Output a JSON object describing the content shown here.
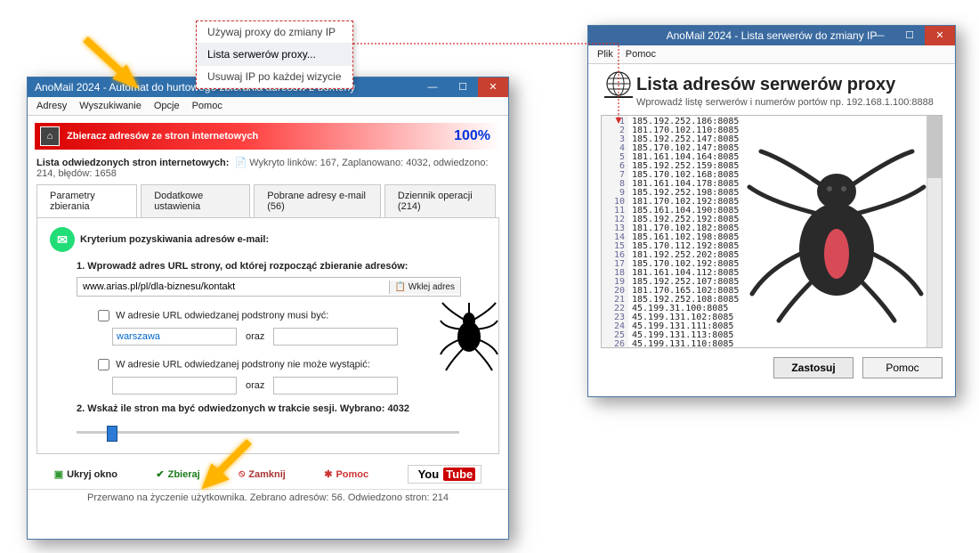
{
  "popup": {
    "items": [
      "Używaj proxy do zmiany IP",
      "Lista serwerów proxy...",
      "Usuwaj IP po każdej wizycie"
    ]
  },
  "main": {
    "title": "AnoMail 2024 - Automat do hurtowego zbierania adresów z domeny",
    "menu": {
      "adresy": "Adresy",
      "wyszukiwanie": "Wyszukiwanie",
      "opcje": "Opcje",
      "pomoc": "Pomoc"
    },
    "banner": "Zbieracz adresów ze stron internetowych",
    "percent": "100%",
    "stats_label": "Lista odwiedzonych stron internetowych:",
    "stats_value": "Wykryto linków: 167, Zaplanowano: 4032, odwiedzono: 214, błędów: 1658",
    "tabs": [
      "Parametry zbierania",
      "Dodatkowe ustawienia",
      "Pobrane adresy e-mail (56)",
      "Dziennik operacji (214)"
    ],
    "criteria_header": "Kryterium pozyskiwania adresów e-mail:",
    "step1": "1. Wprowadź adres URL strony, od której rozpocząć zbieranie adresów:",
    "url": "www.arias.pl/pl/dla-biznesu/kontakt",
    "paste_label": "Wklej adres",
    "must_label": "W adresie URL odwiedzanej podstrony musi być:",
    "must_value": "warszawa",
    "oraz": "oraz",
    "mustnot_label": "W adresie URL odwiedzanej podstrony nie może wystąpić:",
    "step2": "2. Wskaż ile stron ma być odwiedzonych w trakcie sesji. Wybrano: 4032",
    "hide": "Ukryj okno",
    "collect": "Zbieraj",
    "close": "Zamknij",
    "help": "Pomoc",
    "youtube": "You",
    "youtube2": "Tube",
    "status": "Przerwano na życzenie użytkownika. Zebrano adresów: 56. Odwiedzono stron: 214"
  },
  "proxy": {
    "title": "AnoMail 2024 - Lista serwerów do zmiany IP",
    "menu_plik": "Plik",
    "menu_pomoc": "Pomoc",
    "heading": "Lista adresów serwerów proxy",
    "sub": "Wprowadź listę serwerów i numerów portów np. 192.168.1.100:8888",
    "lines": [
      "185.192.252.186:8085",
      "181.170.102.110:8085",
      "185.192.252.147:8085",
      "185.170.102.147:8085",
      "181.161.104.164:8085",
      "185.192.252.159:8085",
      "185.170.102.168:8085",
      "181.161.104.178:8085",
      "185.192.252.198:8085",
      "181.170.102.192:8085",
      "185.161.104.190:8085",
      "185.192.252.192:8085",
      "181.170.102.182:8085",
      "185.161.102.198:8085",
      "185.170.112.192:8085",
      "181.192.252.202:8085",
      "185.170.102.192:8085",
      "181.161.104.112:8085",
      "185.192.252.107:8085",
      "181.170.165.102:8085",
      "185.192.252.108:8085",
      "45.199.31.100:8085",
      "45.199.131.102:8085",
      "45.199.131.111:8085",
      "45.199.131.113:8085",
      "45.199.131.110:8085"
    ],
    "apply": "Zastosuj",
    "help": "Pomoc"
  }
}
